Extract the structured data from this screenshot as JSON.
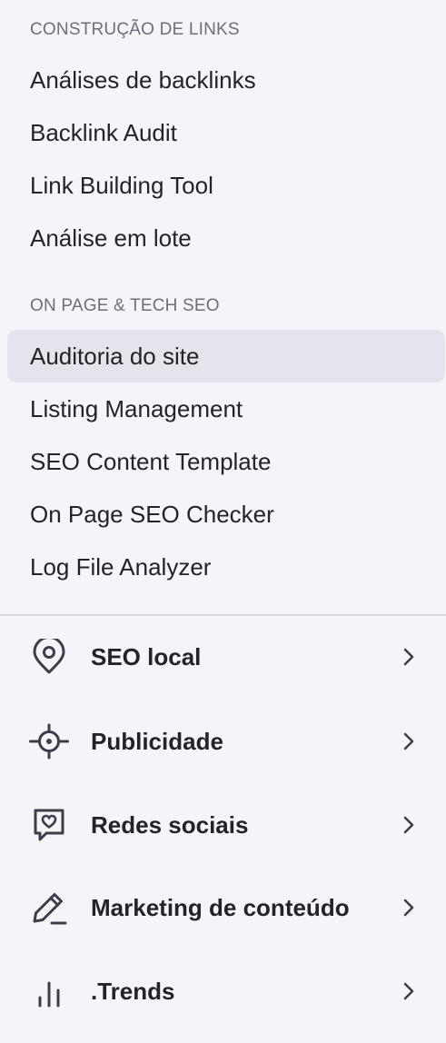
{
  "sections": [
    {
      "heading": "CONSTRUÇÃO DE LINKS",
      "items": [
        {
          "label": "Análises de backlinks"
        },
        {
          "label": "Backlink Audit"
        },
        {
          "label": "Link Building Tool"
        },
        {
          "label": "Análise em lote"
        }
      ]
    },
    {
      "heading": "ON PAGE & TECH SEO",
      "items": [
        {
          "label": "Auditoria do site",
          "active": true
        },
        {
          "label": "Listing Management"
        },
        {
          "label": "SEO Content Template"
        },
        {
          "label": "On Page SEO Checker"
        },
        {
          "label": "Log File Analyzer"
        }
      ]
    }
  ],
  "categories": [
    {
      "label": "SEO local",
      "icon": "map-pin-icon"
    },
    {
      "label": "Publicidade",
      "icon": "target-icon"
    },
    {
      "label": "Redes sociais",
      "icon": "social-chat-icon"
    },
    {
      "label": "Marketing de conteúdo",
      "icon": "pencil-icon"
    },
    {
      "label": ".Trends",
      "icon": "bar-chart-icon"
    }
  ],
  "colors": {
    "background": "#f4f5f9",
    "active_item_background": "#e4e5ec",
    "heading_text": "#6c6e79",
    "item_text": "#212529",
    "icon_stroke": "#3c3e4b",
    "divider": "#d6d8df"
  }
}
